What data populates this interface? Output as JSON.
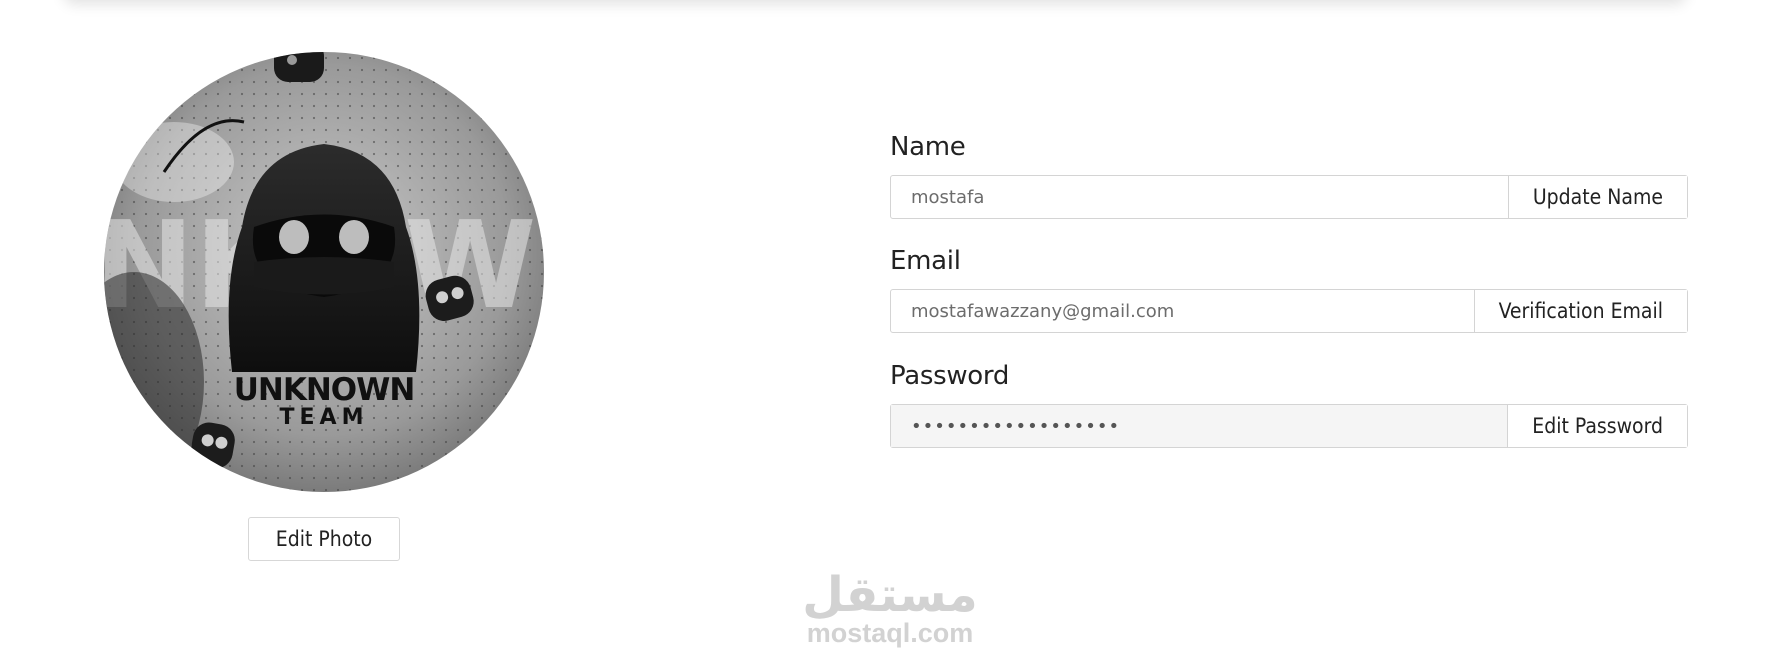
{
  "profile": {
    "avatar_text_line1": "UNKNOWN",
    "avatar_text_line2": "TEAM",
    "edit_photo_label": "Edit Photo"
  },
  "form": {
    "name": {
      "label": "Name",
      "value": "mostafa",
      "button_label": "Update Name"
    },
    "email": {
      "label": "Email",
      "value": "mostafawazzany@gmail.com",
      "button_label": "Verification Email"
    },
    "password": {
      "label": "Password",
      "value": "••••••••••••••••••",
      "button_label": "Edit Password"
    }
  },
  "watermark": {
    "arabic": "مستقل",
    "latin": "mostaql.com"
  }
}
